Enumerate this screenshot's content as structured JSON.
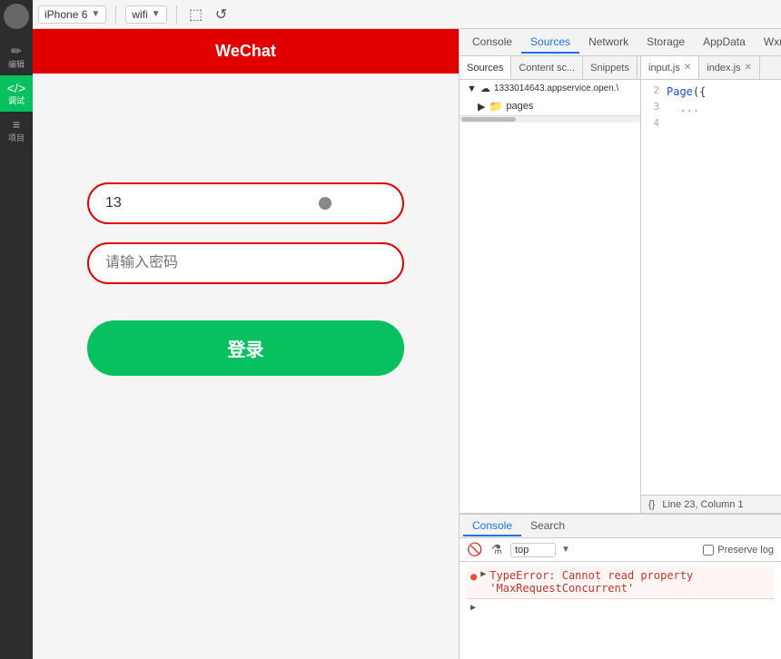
{
  "sidebar": {
    "items": [
      {
        "icon": "👤",
        "label": ""
      },
      {
        "icon": "✏",
        "label": "编辑"
      },
      {
        "icon": "</>",
        "label": "调试",
        "active": true
      },
      {
        "icon": "≡",
        "label": "项目"
      }
    ]
  },
  "topbar": {
    "device": "iPhone 6",
    "network": "wifi",
    "icons": [
      "⬚",
      "↺"
    ]
  },
  "wechat": {
    "header": "WeChat",
    "phone_input_value": "13",
    "phone_placeholder": "请输入密码",
    "login_button": "登录"
  },
  "devtools": {
    "top_tabs": [
      "Console",
      "Sources",
      "Network",
      "Storage",
      "AppData",
      "Wxml"
    ],
    "active_top_tab": "Sources",
    "source_tabs": [
      "Sources",
      "Content sc...",
      "Snippets"
    ],
    "active_source_tab": "Sources",
    "tree": {
      "root": "1333014643.appservice.open.\\",
      "folders": [
        "pages"
      ]
    },
    "code_tabs": [
      {
        "name": "input.js",
        "active": true
      },
      {
        "name": "index.js",
        "active": false
      }
    ],
    "code_lines": [
      {
        "num": "2",
        "content": "Page({"
      },
      {
        "num": "3",
        "content": "  ..."
      },
      {
        "num": "4",
        "content": ""
      }
    ],
    "status_bar": "Line 23, Column 1",
    "console_tabs": [
      "Console",
      "Search"
    ],
    "active_console_tab": "Console",
    "console_filter": "top",
    "preserve_log_label": "Preserve log",
    "error_message": "TypeError: Cannot read property 'MaxRequestConcurrent'"
  }
}
